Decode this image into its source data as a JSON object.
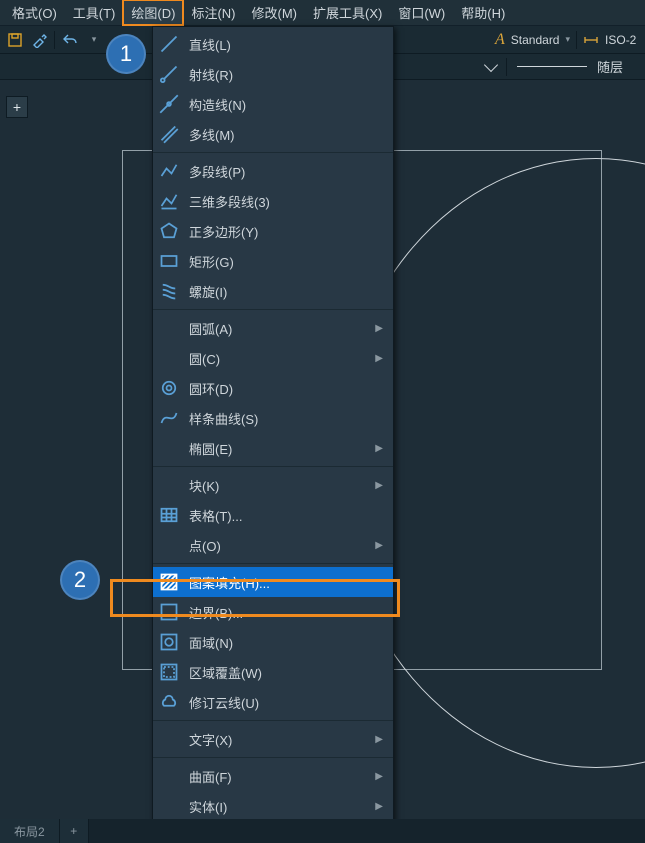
{
  "menubar": {
    "items": [
      {
        "label": "格式(O)"
      },
      {
        "label": "工具(T)"
      },
      {
        "label": "绘图(D)",
        "active": true
      },
      {
        "label": "标注(N)"
      },
      {
        "label": "修改(M)"
      },
      {
        "label": "扩展工具(X)"
      },
      {
        "label": "窗口(W)"
      },
      {
        "label": "帮助(H)"
      }
    ]
  },
  "toolbar": {
    "undo_tip": "撤销",
    "text_style_letter": "A",
    "text_style_value": "Standard",
    "dim_style_value": "ISO-2"
  },
  "layerbar": {
    "layer_label": "随层"
  },
  "plus_tab": "+",
  "badges": {
    "one": "1",
    "two": "2"
  },
  "draw_menu": {
    "items": [
      {
        "icon": "line-icon",
        "label": "直线(L)"
      },
      {
        "icon": "ray-icon",
        "label": "射线(R)"
      },
      {
        "icon": "xline-icon",
        "label": "构造线(N)"
      },
      {
        "icon": "mline-icon",
        "label": "多线(M)"
      },
      {
        "sep": true
      },
      {
        "icon": "pline-icon",
        "label": "多段线(P)"
      },
      {
        "icon": "pline3d-icon",
        "label": "三维多段线(3)"
      },
      {
        "icon": "polygon-icon",
        "label": "正多边形(Y)"
      },
      {
        "icon": "rect-icon",
        "label": "矩形(G)"
      },
      {
        "icon": "helix-icon",
        "label": "螺旋(I)"
      },
      {
        "sep": true
      },
      {
        "icon": "blank",
        "label": "圆弧(A)",
        "sub": true
      },
      {
        "icon": "blank",
        "label": "圆(C)",
        "sub": true
      },
      {
        "icon": "donut-icon",
        "label": "圆环(D)"
      },
      {
        "icon": "spline-icon",
        "label": "样条曲线(S)"
      },
      {
        "icon": "blank",
        "label": "椭圆(E)",
        "sub": true
      },
      {
        "sep": true
      },
      {
        "icon": "blank",
        "label": "块(K)",
        "sub": true
      },
      {
        "icon": "table-icon",
        "label": "表格(T)..."
      },
      {
        "icon": "blank",
        "label": "点(O)",
        "sub": true
      },
      {
        "sep": true
      },
      {
        "icon": "hatch-icon",
        "label": "图案填充(H)...",
        "hi": true
      },
      {
        "icon": "boundary-icon",
        "label": "边界(B)..."
      },
      {
        "icon": "region-icon",
        "label": "面域(N)"
      },
      {
        "icon": "wipeout-icon",
        "label": "区域覆盖(W)"
      },
      {
        "icon": "revcloud-icon",
        "label": "修订云线(U)"
      },
      {
        "sep": true
      },
      {
        "icon": "blank",
        "label": "文字(X)",
        "sub": true
      },
      {
        "sep": true
      },
      {
        "icon": "blank",
        "label": "曲面(F)",
        "sub": true
      },
      {
        "icon": "blank",
        "label": "实体(I)",
        "sub": true
      }
    ]
  },
  "bottom": {
    "tab1": "布局2",
    "plus": "+"
  }
}
